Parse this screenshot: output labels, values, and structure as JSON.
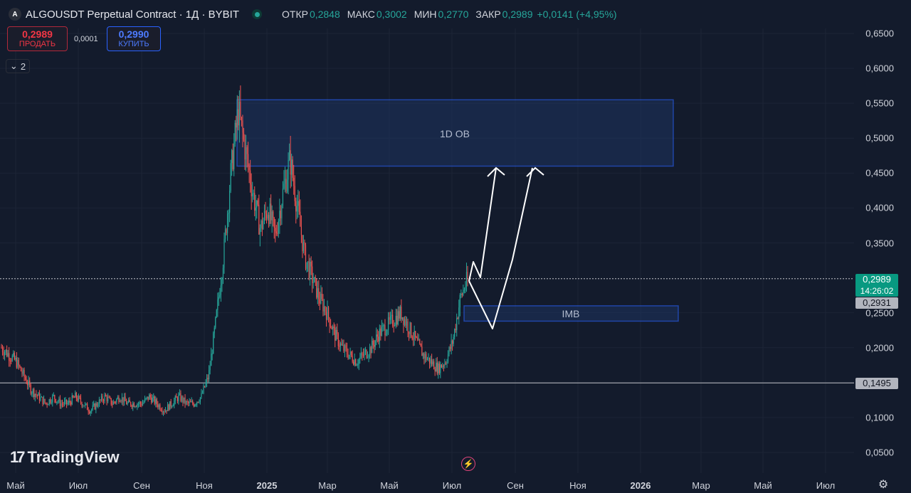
{
  "header": {
    "symbol_title": "ALGOUSDT Perpetual Contract · 1Д · BYBIT",
    "logo_letter": "A",
    "ohlc": [
      {
        "key": "ОТКР",
        "value": "0,2848"
      },
      {
        "key": "МАКС",
        "value": "0,3002"
      },
      {
        "key": "МИН",
        "value": "0,2770"
      },
      {
        "key": "ЗАКР",
        "value": "0,2989"
      },
      {
        "key": "",
        "value": "+0,0141 (+4,95%)"
      }
    ]
  },
  "trade": {
    "sell_price": "0,2989",
    "sell_label": "ПРОДАТЬ",
    "spread": "0,0001",
    "buy_price": "0,2990",
    "buy_label": "КУПИТЬ"
  },
  "indicators_toggle": {
    "count": "2",
    "chevron": "⌄"
  },
  "y_axis": {
    "ticks": [
      "0,6500",
      "0,6000",
      "0,5500",
      "0,5000",
      "0,4500",
      "0,4000",
      "0,3500",
      "0,2500",
      "0,2000",
      "0,1000",
      "0,0500"
    ],
    "tick_values": [
      0.65,
      0.6,
      0.55,
      0.5,
      0.45,
      0.4,
      0.35,
      0.25,
      0.2,
      0.1,
      0.05
    ]
  },
  "x_axis": {
    "labels": [
      "Май",
      "Июл",
      "Сен",
      "Ноя",
      "2025",
      "Мар",
      "Май",
      "Июл",
      "Сен",
      "Ноя",
      "2026",
      "Мар",
      "Май",
      "Июл"
    ],
    "bold": [
      false,
      false,
      false,
      false,
      true,
      false,
      false,
      false,
      false,
      false,
      true,
      false,
      false,
      false
    ]
  },
  "price_tags": {
    "current_price": "0,2989",
    "countdown": "14:26:02",
    "level_1": "0,2931",
    "level_2": "0,1495"
  },
  "zones": {
    "ob_label": "1D OB",
    "imb_label": "IMB"
  },
  "branding": {
    "tv_mark": "17",
    "tv_text": "TradingView"
  },
  "icons": {
    "flash": "⚡",
    "settings": "⚙"
  },
  "colors": {
    "background": "#131b2c",
    "up": "#26a69a",
    "down": "#ef5350",
    "zone_fill": "#1e3a6b",
    "zone_border": "#2962ff",
    "projection": "#ffffff"
  },
  "chart_data": {
    "type": "candlestick",
    "x_range": [
      "2024-05",
      "2026-07"
    ],
    "ylim": [
      0.05,
      0.65
    ],
    "last_price": 0.2989,
    "horizontal_lines": [
      0.2989,
      0.1495
    ],
    "zones": [
      {
        "label": "1D OB",
        "price_low": 0.46,
        "price_high": 0.555
      },
      {
        "label": "IMB",
        "price_low": 0.238,
        "price_high": 0.26
      }
    ],
    "approx_closes": [
      0.2,
      0.19,
      0.18,
      0.16,
      0.14,
      0.13,
      0.12,
      0.13,
      0.12,
      0.12,
      0.13,
      0.12,
      0.11,
      0.12,
      0.13,
      0.12,
      0.13,
      0.12,
      0.12,
      0.12,
      0.13,
      0.12,
      0.11,
      0.12,
      0.13,
      0.12,
      0.12,
      0.13,
      0.16,
      0.24,
      0.33,
      0.45,
      0.54,
      0.48,
      0.42,
      0.37,
      0.4,
      0.36,
      0.42,
      0.47,
      0.4,
      0.33,
      0.3,
      0.27,
      0.25,
      0.22,
      0.2,
      0.19,
      0.18,
      0.19,
      0.2,
      0.22,
      0.23,
      0.24,
      0.25,
      0.23,
      0.21,
      0.19,
      0.18,
      0.17,
      0.18,
      0.21,
      0.27,
      0.2989
    ]
  }
}
